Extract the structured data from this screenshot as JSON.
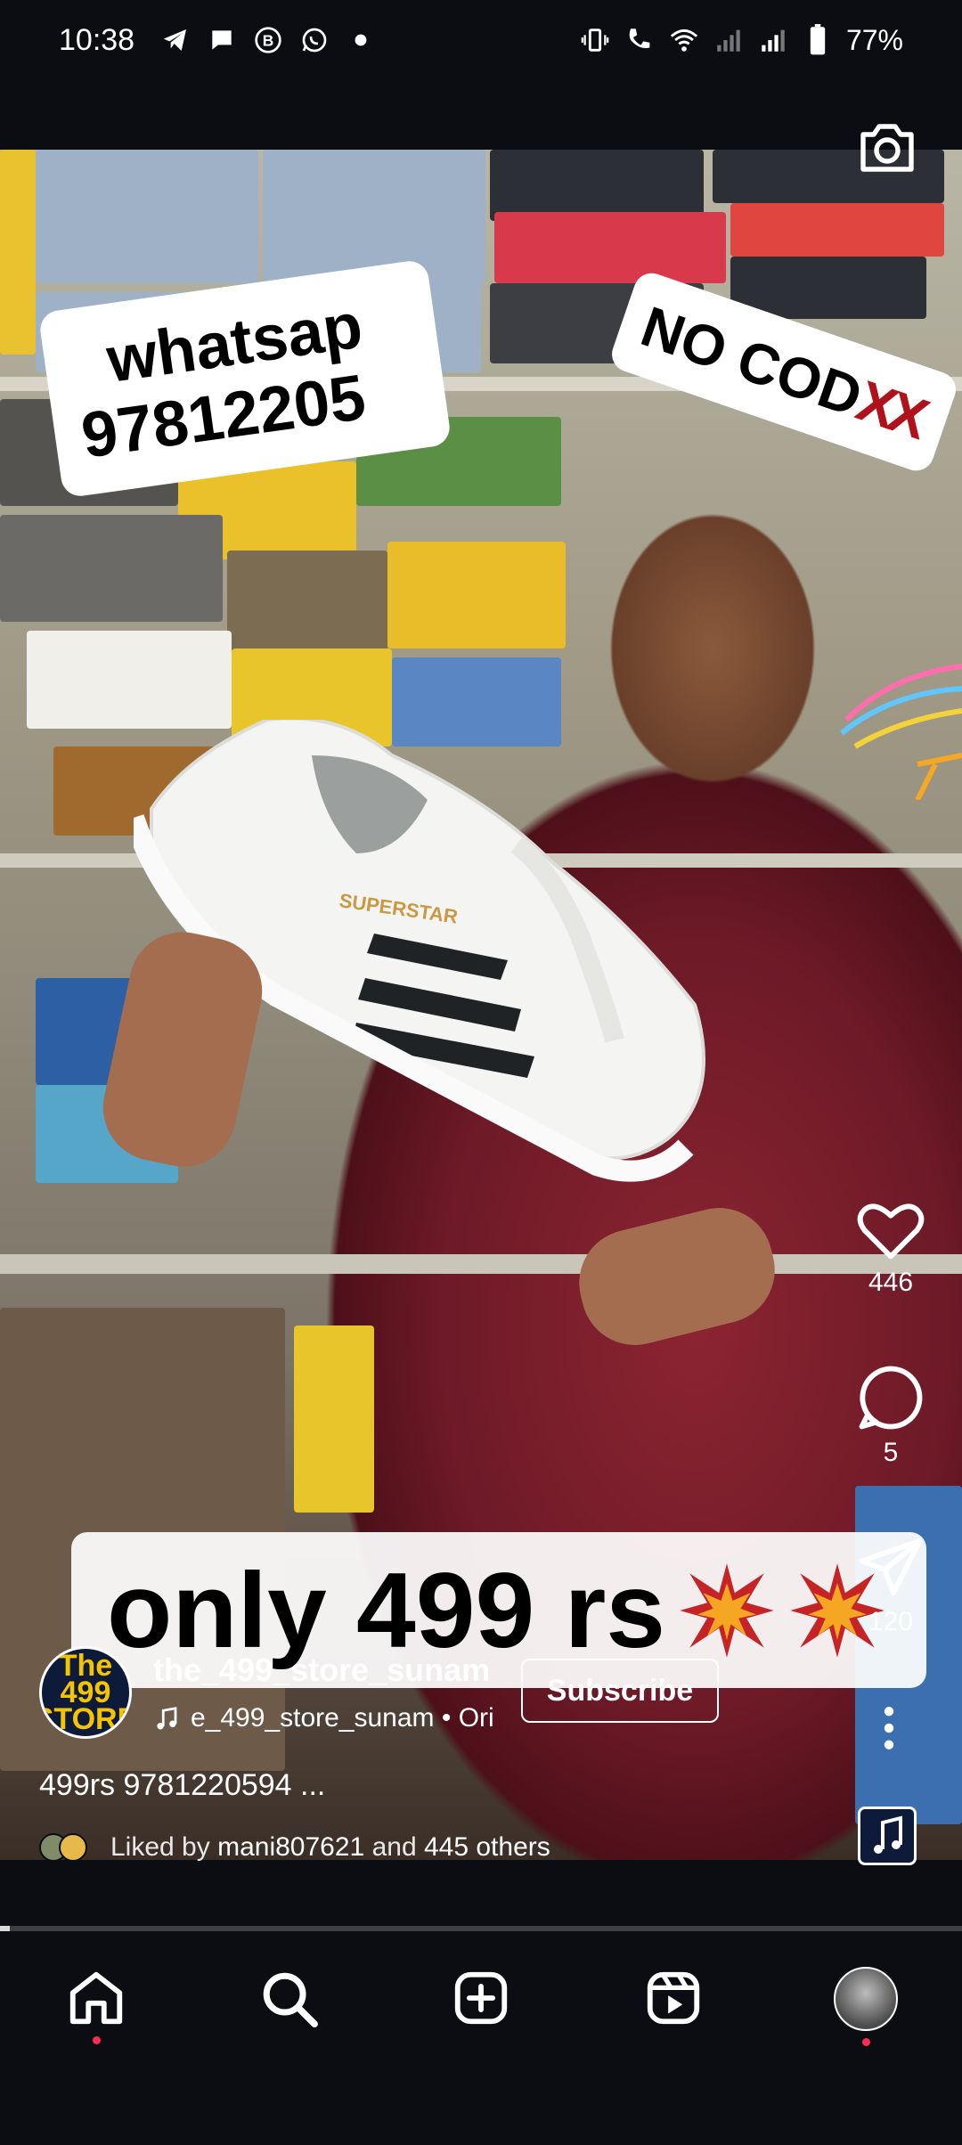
{
  "status_bar": {
    "time": "10:38",
    "left_icons": [
      "telegram-icon",
      "chat-bubble-icon",
      "b-icon",
      "whatsapp-icon",
      "dot-icon"
    ],
    "right_icons": [
      "vibrate-icon",
      "wifi-calling-icon",
      "wifi-icon",
      "signal-icon",
      "signal-icon",
      "battery-icon"
    ],
    "battery": "77%"
  },
  "video": {
    "sticker_whatsapp": {
      "line1": "whatsap",
      "line2": "97812205"
    },
    "sticker_nocod": {
      "text": "NO COD",
      "marks": "XX"
    },
    "price_banner": "only 499 rs",
    "shoe_text": "SUPERSTAR"
  },
  "actions": {
    "likes": "446",
    "comments": "5",
    "shares": "120"
  },
  "post": {
    "avatar_text": "The 499 STORE",
    "username": "the_499_store_sunam",
    "audio": "e_499_store_sunam • Ori",
    "subscribe": "Subscribe",
    "caption": "499rs 9781220594 ...",
    "liked_by_prefix": "Liked by",
    "liked_by_user": "mani807621",
    "liked_by_and": "and",
    "liked_by_others": "445 others"
  },
  "progress": {
    "value": 0.01
  },
  "nav": {
    "items": [
      "home-icon",
      "search-icon",
      "create-icon",
      "reels-icon",
      "profile"
    ]
  },
  "colors": {
    "accent_red": "#b0121b",
    "notification_dot": "#ff2d55",
    "background": "#0b0d12"
  }
}
